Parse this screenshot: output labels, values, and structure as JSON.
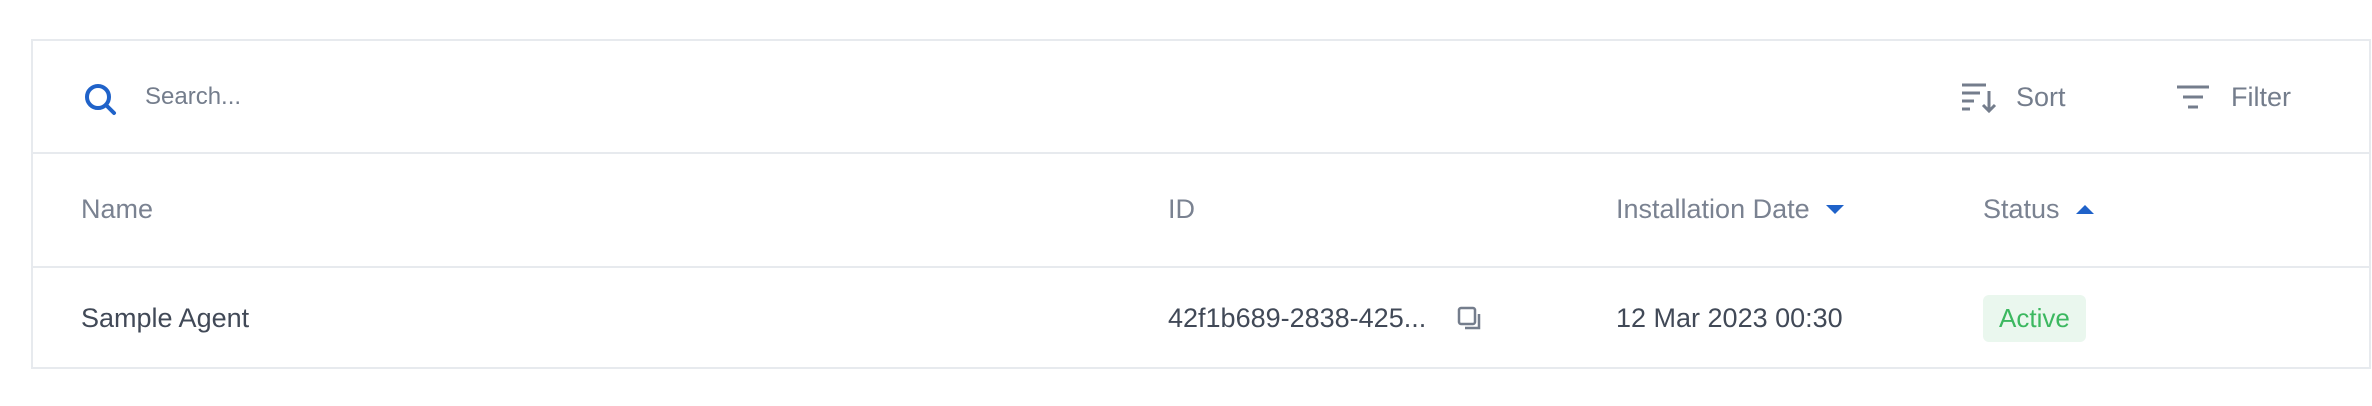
{
  "toolbar": {
    "search": {
      "placeholder": "Search...",
      "value": "",
      "icon": "search-icon"
    },
    "sort": {
      "label": "Sort",
      "icon": "sort-icon"
    },
    "filter": {
      "label": "Filter",
      "icon": "filter-icon"
    }
  },
  "table": {
    "columns": {
      "name": {
        "label": "Name"
      },
      "id": {
        "label": "ID"
      },
      "installation_date": {
        "label": "Installation Date",
        "sort": "descending"
      },
      "status": {
        "label": "Status",
        "sort": "ascending"
      }
    },
    "rows": [
      {
        "name": "Sample Agent",
        "id": "42f1b689-2838-425...",
        "installation_date": "12 Mar 2023 00:30",
        "status": "Active"
      }
    ]
  },
  "colors": {
    "accent": "#1f62c9",
    "border": "#e7eaee",
    "muted_text": "#747d8c",
    "body_text": "#414957",
    "status_active_text": "#3cb860",
    "status_active_bg": "#eaf7ee"
  }
}
